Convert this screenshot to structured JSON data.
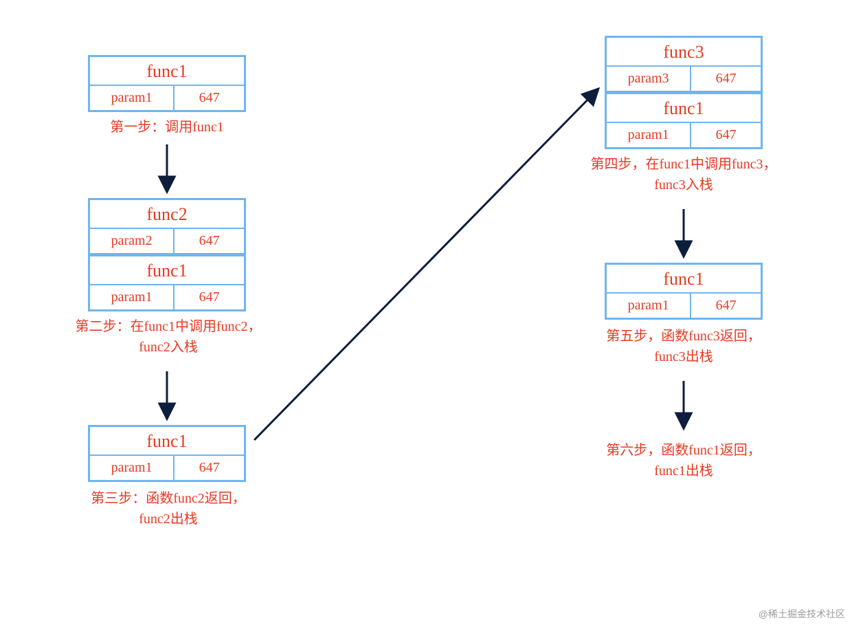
{
  "colors": {
    "border": "#6eb6f0",
    "text": "#e83a22",
    "arrow": "#0c1e3c"
  },
  "step1": {
    "frames": [
      {
        "name": "func1",
        "param": "param1",
        "value": "647"
      }
    ],
    "caption": "第一步：调用func1"
  },
  "step2": {
    "frames": [
      {
        "name": "func2",
        "param": "param2",
        "value": "647"
      },
      {
        "name": "func1",
        "param": "param1",
        "value": "647"
      }
    ],
    "caption": "第二步：在func1中调用func2，\nfunc2入栈"
  },
  "step3": {
    "frames": [
      {
        "name": "func1",
        "param": "param1",
        "value": "647"
      }
    ],
    "caption": "第三步：函数func2返回，\nfunc2出栈"
  },
  "step4": {
    "frames": [
      {
        "name": "func3",
        "param": "param3",
        "value": "647"
      },
      {
        "name": "func1",
        "param": "param1",
        "value": "647"
      }
    ],
    "caption": "第四步，在func1中调用func3，\nfunc3入栈"
  },
  "step5": {
    "frames": [
      {
        "name": "func1",
        "param": "param1",
        "value": "647"
      }
    ],
    "caption": "第五步，函数func3返回，\nfunc3出栈"
  },
  "step6": {
    "caption": "第六步，函数func1返回，\nfunc1出栈"
  },
  "watermark": "@稀土掘金技术社区"
}
